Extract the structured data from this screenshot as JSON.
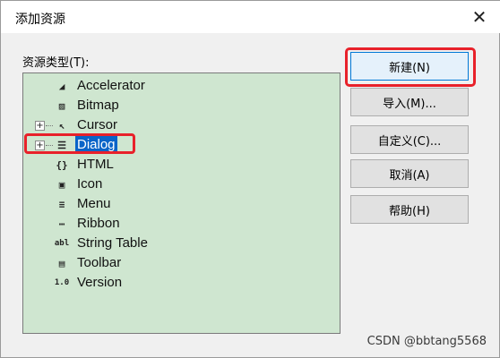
{
  "dialog": {
    "title": "添加资源",
    "close_glyph": "✕",
    "type_label": "资源类型(T):"
  },
  "tree": {
    "items": [
      {
        "label": "Accelerator",
        "icon": "accelerator-icon",
        "glyph": "◢",
        "expander": false,
        "selected": false
      },
      {
        "label": "Bitmap",
        "icon": "bitmap-icon",
        "glyph": "▨",
        "expander": false,
        "selected": false
      },
      {
        "label": "Cursor",
        "icon": "cursor-icon",
        "glyph": "↖",
        "expander": true,
        "selected": false
      },
      {
        "label": "Dialog",
        "icon": "dialog-icon",
        "glyph": "☰",
        "expander": true,
        "selected": true
      },
      {
        "label": "HTML",
        "icon": "html-icon",
        "glyph": "{}",
        "expander": false,
        "selected": false
      },
      {
        "label": "Icon",
        "icon": "icon-resource-icon",
        "glyph": "▣",
        "expander": false,
        "selected": false
      },
      {
        "label": "Menu",
        "icon": "menu-icon",
        "glyph": "≡",
        "expander": false,
        "selected": false
      },
      {
        "label": "Ribbon",
        "icon": "ribbon-icon",
        "glyph": "⋯",
        "expander": false,
        "selected": false
      },
      {
        "label": "String Table",
        "icon": "string-table-icon",
        "glyph": "abl",
        "expander": false,
        "selected": false
      },
      {
        "label": "Toolbar",
        "icon": "toolbar-icon",
        "glyph": "▤",
        "expander": false,
        "selected": false
      },
      {
        "label": "Version",
        "icon": "version-icon",
        "glyph": "1.0",
        "expander": false,
        "selected": false
      }
    ],
    "expander_glyph": "+"
  },
  "buttons": {
    "new": "新建(N)",
    "import": "导入(M)...",
    "custom": "自定义(C)...",
    "cancel": "取消(A)",
    "help": "帮助(H)"
  },
  "watermark": "CSDN @bbtang5568",
  "colors": {
    "tree_background": "#cfe6d0",
    "selection": "#0a64c8",
    "highlight_box": "#e8212a",
    "primary_border": "#0078d7"
  }
}
